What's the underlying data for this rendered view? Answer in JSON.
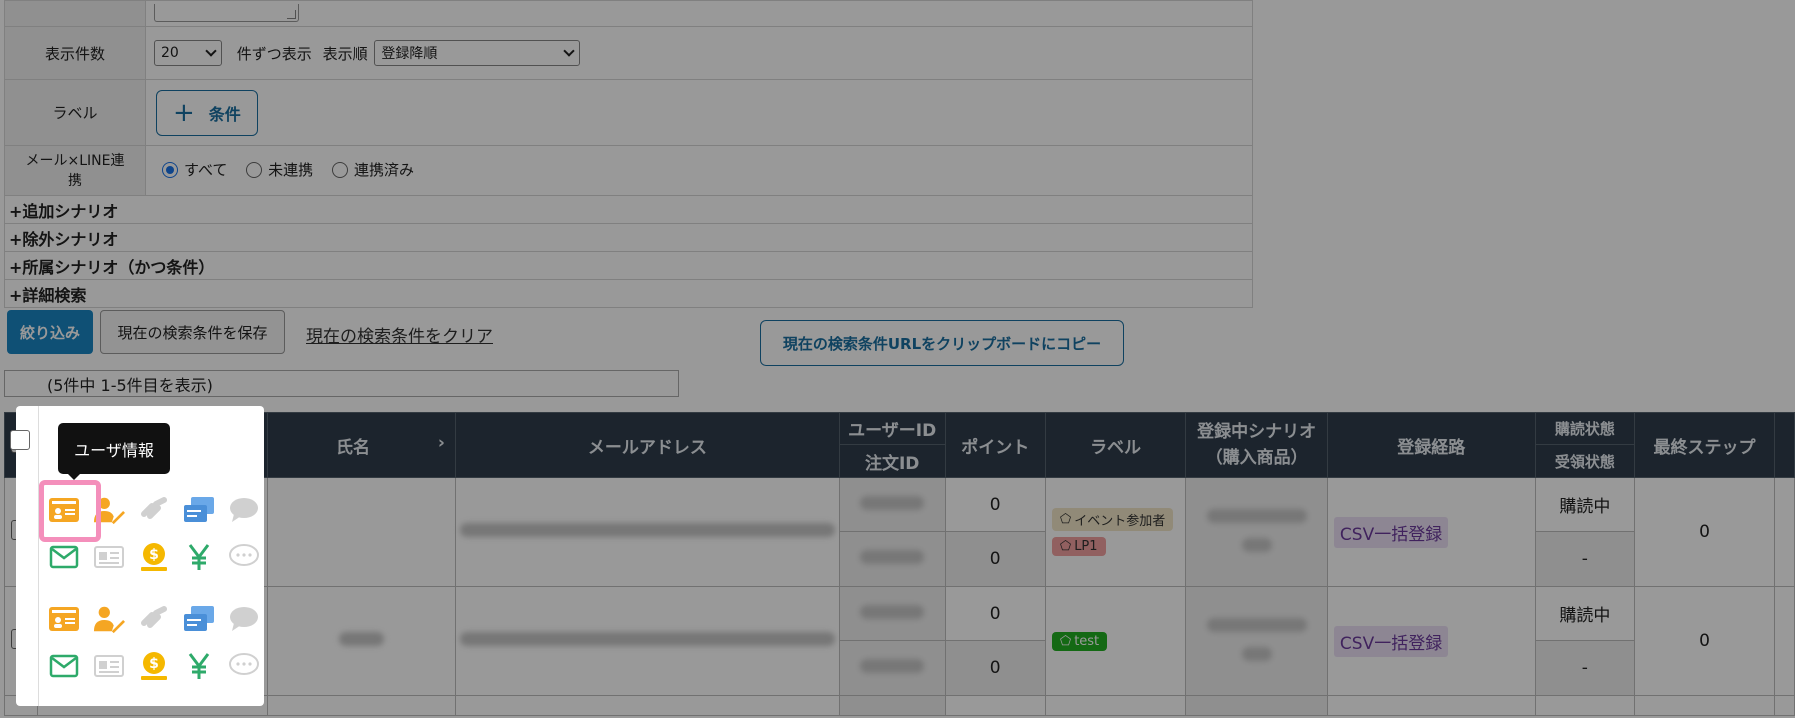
{
  "form": {
    "display_count_label": "表示件数",
    "display_count_value": "20",
    "per_page_text": "件ずつ表示",
    "sort_label": "表示順",
    "sort_value": "登録降順",
    "label_row_label": "ラベル",
    "condition_button": "条件",
    "link_label": "メール×LINE連携",
    "radio_options": [
      "すべて",
      "未連携",
      "連携済み"
    ],
    "expanders": [
      "+追加シナリオ",
      "+除外シナリオ",
      "+所属シナリオ（かつ条件）",
      "+詳細検索"
    ]
  },
  "actions": {
    "filter": "絞り込み",
    "save": "現在の検索条件を保存",
    "clear": "現在の検索条件をクリア",
    "copy_url": "現在の検索条件URLをクリップボードにコピー"
  },
  "count_text": "(5件中 1-5件目を表示)",
  "table": {
    "headers": {
      "name": "氏名",
      "email": "メールアドレス",
      "user_id": "ユーザーID",
      "order_id": "注文ID",
      "point": "ポイント",
      "label": "ラベル",
      "scenario": "登録中シナリオ（購入商品）",
      "route": "登録経路",
      "sub_status": "購読状態",
      "recv_status": "受領状態",
      "last_step": "最終ステップ"
    },
    "rows": [
      {
        "points": [
          "0",
          "0"
        ],
        "labels": [
          "イベント参加者",
          "LP1"
        ],
        "route": "CSV一括登録",
        "sub_status": "購読中",
        "recv_status": "-",
        "last_step": "0"
      },
      {
        "points": [
          "0",
          "0"
        ],
        "labels": [
          "test"
        ],
        "route": "CSV一括登録",
        "sub_status": "購読中",
        "recv_status": "-",
        "last_step": "0"
      }
    ]
  },
  "tooltip": "ユーザ情報",
  "colors": {
    "header_bg": "#2f3d4c",
    "primary": "#1a86c4",
    "highlight": "#f48fbb",
    "label_event": "#f2e7c8",
    "label_lp1": "#f2a0a0",
    "label_test": "#22b022",
    "icon_orange": "#f5a623",
    "icon_blue": "#6aa8e8",
    "icon_green": "#2eaa6a"
  }
}
